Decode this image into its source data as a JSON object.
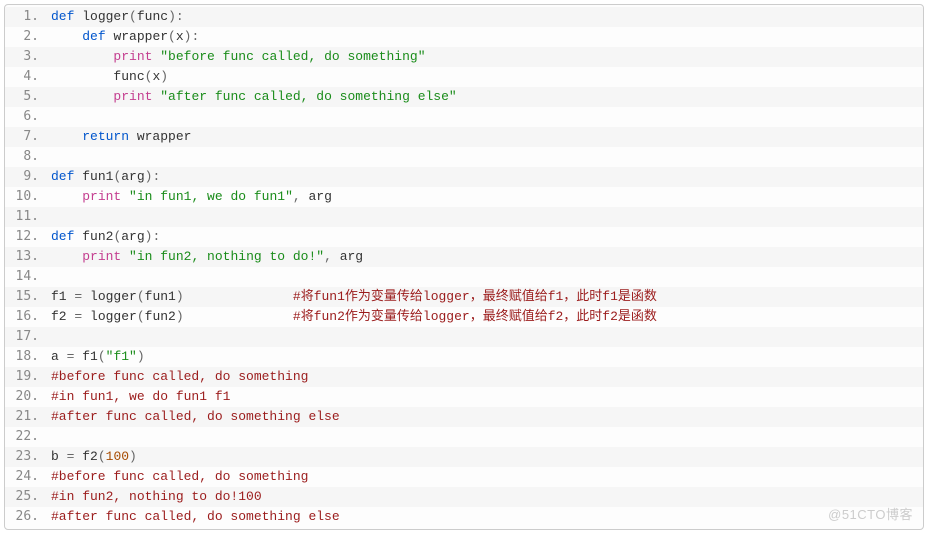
{
  "watermark": "@51CTO博客",
  "code": {
    "lines": [
      {
        "n": 1,
        "tokens": [
          [
            "kw",
            "def "
          ],
          [
            "fn",
            "logger"
          ],
          [
            "punct",
            "("
          ],
          [
            "name",
            "func"
          ],
          [
            "punct",
            "):"
          ]
        ]
      },
      {
        "n": 2,
        "tokens": [
          [
            "name",
            "    "
          ],
          [
            "kw",
            "def "
          ],
          [
            "fn",
            "wrapper"
          ],
          [
            "punct",
            "("
          ],
          [
            "name",
            "x"
          ],
          [
            "punct",
            "):"
          ]
        ]
      },
      {
        "n": 3,
        "tokens": [
          [
            "name",
            "        "
          ],
          [
            "builtin",
            "print"
          ],
          [
            "name",
            " "
          ],
          [
            "str",
            "\"before func called, do something\""
          ]
        ]
      },
      {
        "n": 4,
        "tokens": [
          [
            "name",
            "        "
          ],
          [
            "fn",
            "func"
          ],
          [
            "punct",
            "("
          ],
          [
            "name",
            "x"
          ],
          [
            "punct",
            ")"
          ]
        ]
      },
      {
        "n": 5,
        "tokens": [
          [
            "name",
            "        "
          ],
          [
            "builtin",
            "print"
          ],
          [
            "name",
            " "
          ],
          [
            "str",
            "\"after func called, do something else\""
          ]
        ]
      },
      {
        "n": 6,
        "tokens": []
      },
      {
        "n": 7,
        "tokens": [
          [
            "name",
            "    "
          ],
          [
            "kw",
            "return "
          ],
          [
            "name",
            "wrapper"
          ]
        ]
      },
      {
        "n": 8,
        "tokens": []
      },
      {
        "n": 9,
        "tokens": [
          [
            "kw",
            "def "
          ],
          [
            "fn",
            "fun1"
          ],
          [
            "punct",
            "("
          ],
          [
            "name",
            "arg"
          ],
          [
            "punct",
            "):"
          ]
        ]
      },
      {
        "n": 10,
        "tokens": [
          [
            "name",
            "    "
          ],
          [
            "builtin",
            "print"
          ],
          [
            "name",
            " "
          ],
          [
            "str",
            "\"in fun1, we do fun1\""
          ],
          [
            "punct",
            ", "
          ],
          [
            "name",
            "arg"
          ]
        ]
      },
      {
        "n": 11,
        "tokens": []
      },
      {
        "n": 12,
        "tokens": [
          [
            "kw",
            "def "
          ],
          [
            "fn",
            "fun2"
          ],
          [
            "punct",
            "("
          ],
          [
            "name",
            "arg"
          ],
          [
            "punct",
            "):"
          ]
        ]
      },
      {
        "n": 13,
        "tokens": [
          [
            "name",
            "    "
          ],
          [
            "builtin",
            "print"
          ],
          [
            "name",
            " "
          ],
          [
            "str",
            "\"in fun2, nothing to do!\""
          ],
          [
            "punct",
            ", "
          ],
          [
            "name",
            "arg"
          ]
        ]
      },
      {
        "n": 14,
        "tokens": []
      },
      {
        "n": 15,
        "tokens": [
          [
            "name",
            "f1 "
          ],
          [
            "punct",
            "= "
          ],
          [
            "fn",
            "logger"
          ],
          [
            "punct",
            "("
          ],
          [
            "name",
            "fun1"
          ],
          [
            "punct",
            ")"
          ],
          [
            "name",
            "              "
          ],
          [
            "comment",
            "#将fun1作为变量传给logger，最终赋值给f1，此时f1是函数"
          ]
        ]
      },
      {
        "n": 16,
        "tokens": [
          [
            "name",
            "f2 "
          ],
          [
            "punct",
            "= "
          ],
          [
            "fn",
            "logger"
          ],
          [
            "punct",
            "("
          ],
          [
            "name",
            "fun2"
          ],
          [
            "punct",
            ")"
          ],
          [
            "name",
            "              "
          ],
          [
            "comment",
            "#将fun2作为变量传给logger，最终赋值给f2，此时f2是函数"
          ]
        ]
      },
      {
        "n": 17,
        "tokens": []
      },
      {
        "n": 18,
        "tokens": [
          [
            "name",
            "a "
          ],
          [
            "punct",
            "= "
          ],
          [
            "fn",
            "f1"
          ],
          [
            "punct",
            "("
          ],
          [
            "str",
            "\"f1\""
          ],
          [
            "punct",
            ")"
          ]
        ]
      },
      {
        "n": 19,
        "tokens": [
          [
            "comment",
            "#before func called, do something"
          ]
        ]
      },
      {
        "n": 20,
        "tokens": [
          [
            "comment",
            "#in fun1, we do fun1 f1"
          ]
        ]
      },
      {
        "n": 21,
        "tokens": [
          [
            "comment",
            "#after func called, do something else"
          ]
        ]
      },
      {
        "n": 22,
        "tokens": []
      },
      {
        "n": 23,
        "tokens": [
          [
            "name",
            "b "
          ],
          [
            "punct",
            "= "
          ],
          [
            "fn",
            "f2"
          ],
          [
            "punct",
            "("
          ],
          [
            "num",
            "100"
          ],
          [
            "punct",
            ")"
          ]
        ]
      },
      {
        "n": 24,
        "tokens": [
          [
            "comment",
            "#before func called, do something"
          ]
        ]
      },
      {
        "n": 25,
        "tokens": [
          [
            "comment",
            "#in fun2, nothing to do!100"
          ]
        ]
      },
      {
        "n": 26,
        "tokens": [
          [
            "comment",
            "#after func called, do something else"
          ]
        ]
      }
    ]
  }
}
